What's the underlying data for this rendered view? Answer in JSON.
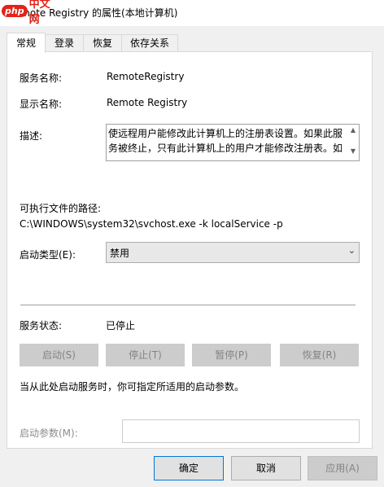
{
  "window": {
    "title": "Remote Registry 的属性(本地计算机)"
  },
  "watermark": {
    "logo": "php",
    "text": "中文网"
  },
  "tabs": [
    {
      "label": "常规"
    },
    {
      "label": "登录"
    },
    {
      "label": "恢复"
    },
    {
      "label": "依存关系"
    }
  ],
  "general": {
    "service_name_label": "服务名称:",
    "service_name": "RemoteRegistry",
    "display_name_label": "显示名称:",
    "display_name": "Remote Registry",
    "description_label": "描述:",
    "description": "使远程用户能修改此计算机上的注册表设置。如果此服务被终止，只有此计算机上的用户才能修改注册表。如",
    "exe_path_label": "可执行文件的路径:",
    "exe_path": "C:\\WINDOWS\\system32\\svchost.exe -k localService -p",
    "startup_type_label": "启动类型(E):",
    "startup_type_value": "禁用",
    "service_status_label": "服务状态:",
    "service_status": "已停止",
    "buttons": {
      "start": "启动(S)",
      "stop": "停止(T)",
      "pause": "暂停(P)",
      "resume": "恢复(R)"
    },
    "hint": "当从此处启动服务时，你可指定所适用的启动参数。",
    "start_params_label": "启动参数(M):",
    "start_params_value": ""
  },
  "footer": {
    "ok": "确定",
    "cancel": "取消",
    "apply": "应用(A)"
  },
  "colors": {
    "dialog_bg": "#f0f0f0",
    "panel_bg": "#ffffff",
    "disabled_text": "#8c8c8c",
    "focus_border": "#0078d7"
  }
}
